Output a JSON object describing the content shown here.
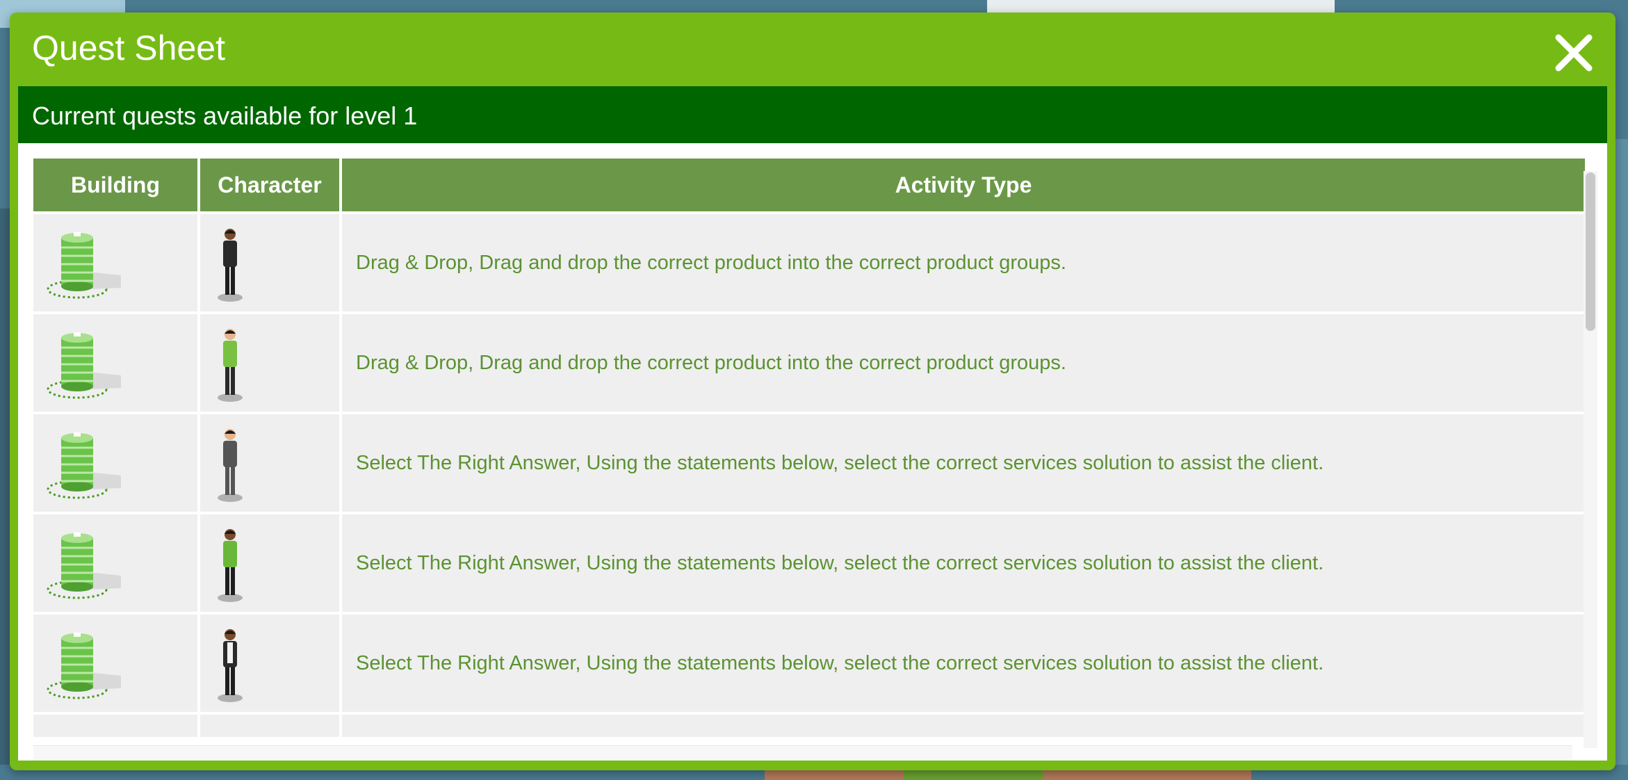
{
  "modal": {
    "title": "Quest Sheet",
    "subtitle": "Current quests available for level 1"
  },
  "table": {
    "headers": [
      "Building",
      "Character",
      "Activity Type"
    ],
    "rows": [
      {
        "building_icon": "green-tower-building-icon",
        "character_icon": "man-in-dark-suit-icon",
        "activity": "Drag & Drop, Drag and drop the correct product into the correct product groups."
      },
      {
        "building_icon": "green-tower-building-icon",
        "character_icon": "woman-in-green-top-icon",
        "activity": "Drag & Drop, Drag and drop the correct product into the correct product groups."
      },
      {
        "building_icon": "green-tower-building-icon",
        "character_icon": "woman-in-grey-dress-icon",
        "activity": "Select The Right Answer, Using the statements below, select the correct services solution to assist the client."
      },
      {
        "building_icon": "green-tower-building-icon",
        "character_icon": "woman-in-green-blouse-icon",
        "activity": "Select The Right Answer, Using the statements below, select the correct services solution to assist the client."
      },
      {
        "building_icon": "green-tower-building-icon",
        "character_icon": "man-with-green-tie-icon",
        "activity": "Select The Right Answer, Using the statements below, select the correct services solution to assist the client."
      }
    ]
  },
  "colors": {
    "modal_frame": "#76bb15",
    "subheader": "#006600",
    "table_header": "#6b9848",
    "row_bg": "#efefef",
    "activity_text": "#5b9232"
  }
}
